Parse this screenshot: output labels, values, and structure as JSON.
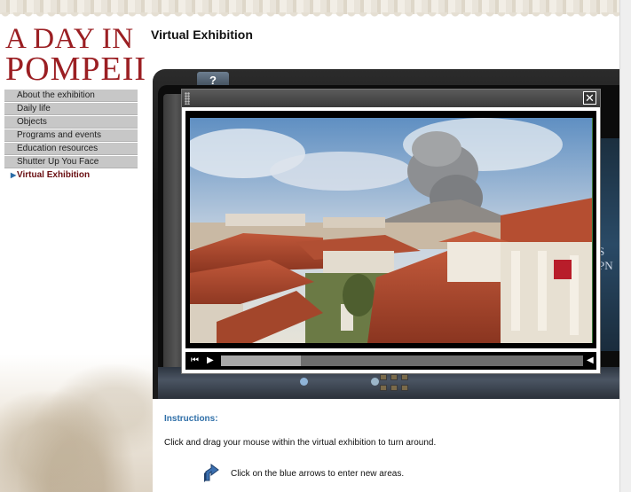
{
  "logo": {
    "line1": "A DAY IN",
    "line2": "POMPEII"
  },
  "nav": {
    "items": [
      {
        "label": "About the exhibition"
      },
      {
        "label": "Daily life"
      },
      {
        "label": "Objects"
      },
      {
        "label": "Programs and events"
      },
      {
        "label": "Education resources"
      },
      {
        "label": "Shutter Up You Face"
      },
      {
        "label": "Virtual Exhibition",
        "active": true
      }
    ]
  },
  "page": {
    "title": "Virtual Exhibition"
  },
  "viewer": {
    "help_label": "?",
    "side_text": "S PN"
  },
  "video_player": {
    "close_label": "✕",
    "rewind_label": "⏮",
    "play_label": "▶",
    "volume_label": "◀",
    "progress": 0.22
  },
  "instructions": {
    "title": "Instructions:",
    "drag_text": "Click and drag your mouse within the virtual exhibition to turn around.",
    "arrows_text": "Click on the blue arrows to enter new areas."
  },
  "colors": {
    "brand_red": "#9b1f23",
    "instructions_blue": "#2f6fa8",
    "nav_bg": "#c7c7c7"
  }
}
